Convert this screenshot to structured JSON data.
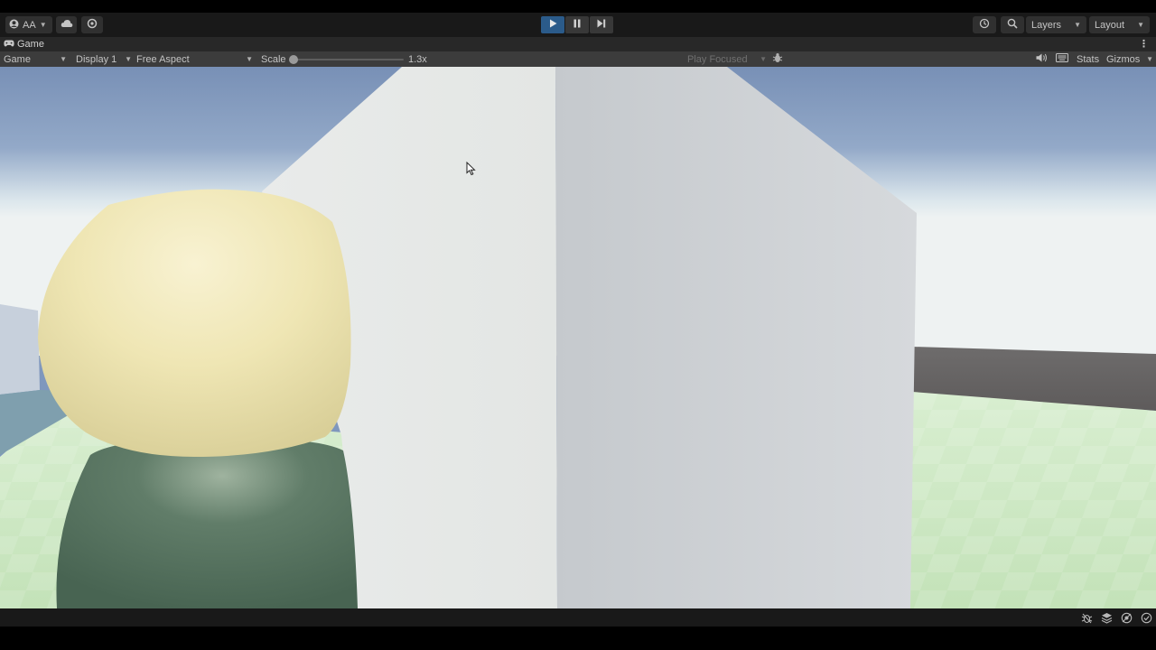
{
  "toolbar": {
    "account_label": "AA",
    "cloud_icon": "cloud-icon",
    "collab_icon": "collab-icon",
    "play_icon": "play-icon",
    "pause_icon": "pause-icon",
    "step_icon": "step-icon",
    "history_icon": "history-icon",
    "search_icon": "search-icon",
    "layers_label": "Layers",
    "layout_label": "Layout",
    "play_active_color": "#2b5b8a"
  },
  "tab": {
    "label": "Game",
    "icon": "gamepad-icon"
  },
  "game_bar": {
    "mode_label": "Game",
    "display_label": "Display 1",
    "aspect_label": "Free Aspect",
    "scale_label": "Scale",
    "scale_value": "1.3x",
    "scale_fraction": 0.0,
    "play_focused_label": "Play Focused",
    "stats_label": "Stats",
    "gizmos_label": "Gizmos"
  },
  "scene": {
    "sky_top": "#7b93b9",
    "sky_horizon": "#dfe9ee",
    "ground": "#cfe7c5",
    "cube_left": "#e6e8e6",
    "cube_right": "#c8ccd0",
    "head": "#efe7b6",
    "body": "#55725e"
  },
  "status_icons": [
    "bug-icon",
    "layers-stack-icon",
    "network-icon",
    "check-circle-icon"
  ]
}
